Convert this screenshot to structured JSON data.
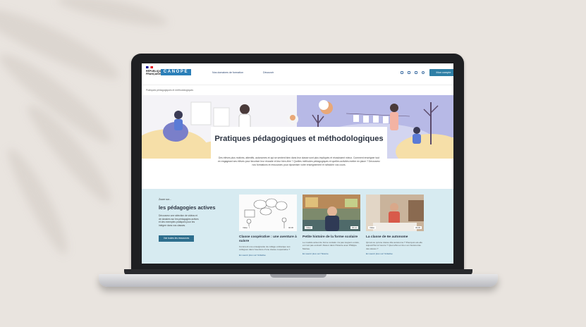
{
  "header": {
    "gov_label": "RÉPUBLIQUE FRANÇAISE",
    "brand": "CANOPÉ",
    "nav": [
      "Nos domaines de formation",
      "Découvrir"
    ],
    "account_button": "Mon compte"
  },
  "breadcrumb": "Pratiques pédagogiques et méthodologiques",
  "hero": {
    "title": "Pratiques pédagogiques et méthodologiques",
    "text": "Des élèves plus motivés, attentifs, autonomes et qui se sentent bien dans leur classe sont plus impliqués et réussissent mieux. Comment enseigner tout en engageant ses élèves pour favoriser leur réussite et leur bien-être ? Quelles méthodes pédagogiques et quelles activités mettre en place ? Découvrez nos formations et ressources pour dynamiser votre enseignement et rafraîchir vos cours."
  },
  "zoom": {
    "kicker": "Zoom sur...",
    "title": "les pédagogies actives",
    "text": "Découvrez une sélection de vidéos et de dossiers sur les pédagogies actives et des exemples pratiques pour les intégrer dans vos classes.",
    "button": "Voir toutes les ressources"
  },
  "cards": [
    {
      "tag_left": "Vidéo",
      "tag_right": "02:30",
      "title": "Classe coopérative : une aventure à suivre",
      "text": "Comment une enseignante de collège embarque ses collègues dans l'aventure d'une classe coopérative ?",
      "link": "En savoir plus sur l'initiative"
    },
    {
      "tag_left": "Vidéo",
      "tag_right": "05:12",
      "title": "Petite histoire de la forme scolaire",
      "text": "Le modèle actuel de forme scolaire n'a pas toujours existé, et n'est pas exclusif. Retour dans l'histoire avec Philippe Meirieu.",
      "link": "En savoir plus sur l'histoire"
    },
    {
      "tag_left": "Vidéo",
      "tag_right": "03:45",
      "title": "La classe de 6e autonome",
      "text": "Qu'est-ce qu'une classe dite autonome ? Pourquoi est-elle aujourd'hui à l'œuvre ? Quel effet en tire-t-on l'autonomie des élèves ?",
      "link": "En savoir plus sur l'initiative"
    }
  ]
}
